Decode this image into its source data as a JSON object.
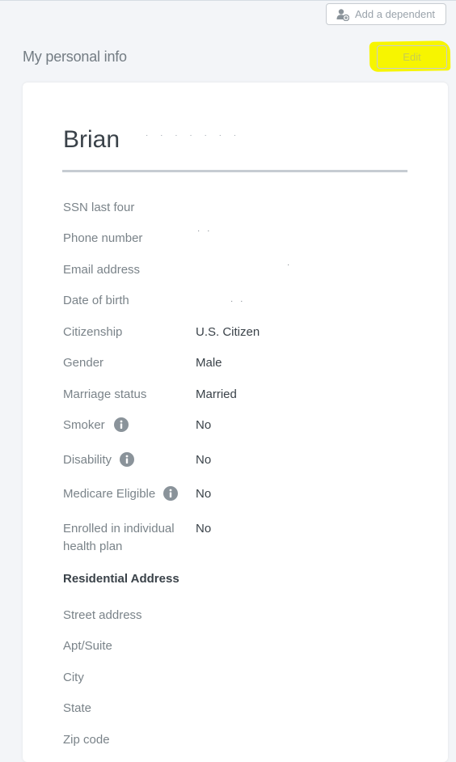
{
  "header": {
    "add_dependent_label": "Add a dependent",
    "edit_label": "Edit",
    "title": "My personal info"
  },
  "profile": {
    "first_name": "Brian",
    "last_name_redacted": "· · · · · · ·"
  },
  "fields": [
    {
      "label": "SSN last four",
      "value": ""
    },
    {
      "label": "Phone number",
      "value": "· ·"
    },
    {
      "label": "Email address",
      "value": "·"
    },
    {
      "label": "Date of birth",
      "value": "· ·"
    },
    {
      "label": "Citizenship",
      "value": "U.S. Citizen"
    },
    {
      "label": "Gender",
      "value": "Male"
    },
    {
      "label": "Marriage status",
      "value": "Married"
    },
    {
      "label": "Smoker",
      "value": "No",
      "icon": "info-icon"
    },
    {
      "label": "Disability",
      "value": "No",
      "icon": "info-icon"
    },
    {
      "label": "Medicare Eligible",
      "value": "No",
      "icon": "info-icon"
    },
    {
      "label": "Enrolled in individual health plan",
      "value": "No"
    }
  ],
  "address": {
    "heading": "Residential Address",
    "fields": [
      {
        "label": "Street address"
      },
      {
        "label": "Apt/Suite"
      },
      {
        "label": "City"
      },
      {
        "label": "State"
      },
      {
        "label": "Zip code"
      }
    ]
  },
  "colors": {
    "highlight": "#f7f500",
    "info_icon": "#8a939a"
  }
}
